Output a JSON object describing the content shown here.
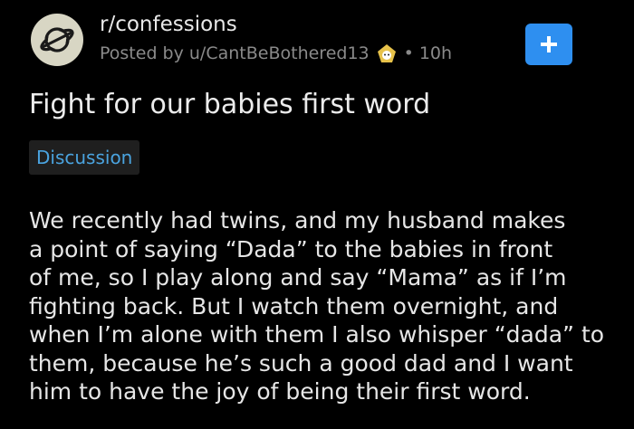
{
  "post": {
    "subreddit": "r/confessions",
    "posted_by_prefix": "Posted by ",
    "username": "u/CantBeBothered13",
    "dot": "•",
    "age": "10h",
    "join_label": "+",
    "title": "Fight for our babies first word",
    "flair": "Discussion",
    "body_lines": [
      "We recently had twins, and my husband makes",
      "a point of saying “Dada” to the babies in front",
      "of me, so I play along and say “Mama” as if I’m",
      "fighting back. But I watch them overnight, and",
      "when I’m alone with them I also whisper “dada” to",
      "them, because he’s such a good dad and I want",
      "him to have the joy of being their first word."
    ]
  },
  "icons": {
    "avatar": "planet-icon",
    "flair": "snoo-flair-icon",
    "join": "plus-icon"
  },
  "colors": {
    "background": "#000000",
    "accent": "#2e8ff0",
    "flair_text": "#4aa3df",
    "flair_bg": "#1f1f1f",
    "meta_text": "#8a8a8a"
  }
}
